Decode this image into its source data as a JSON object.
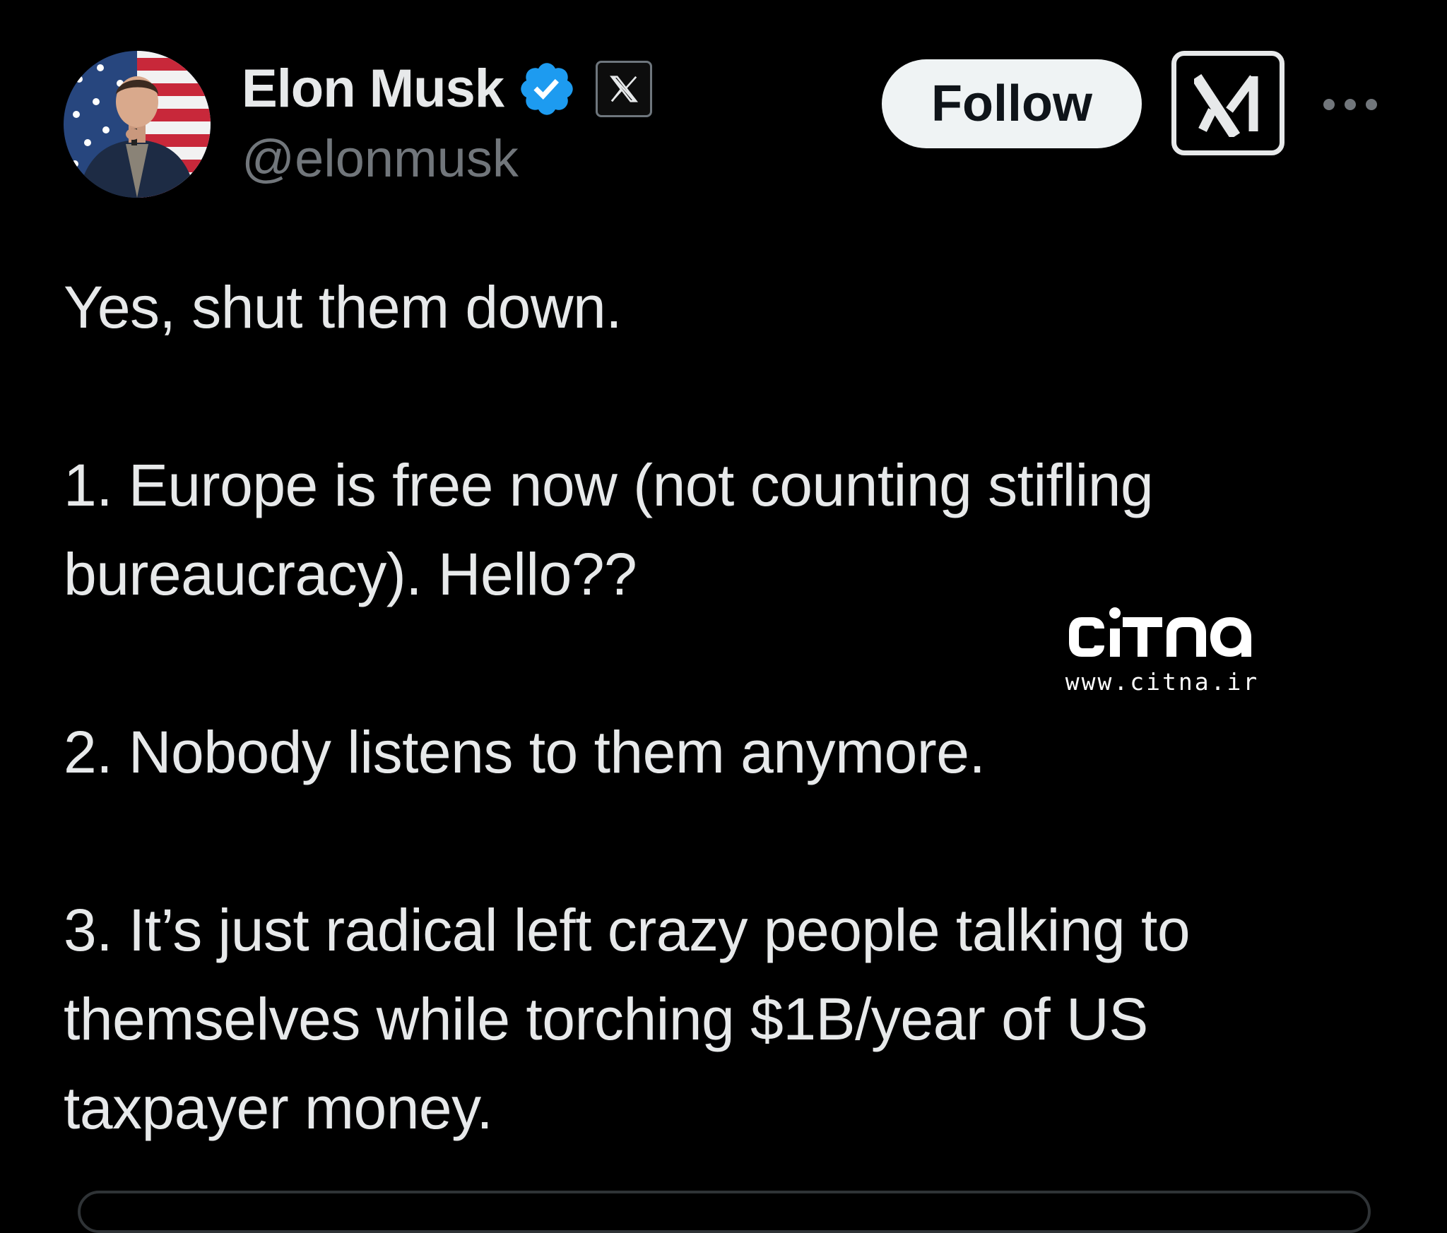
{
  "author": {
    "display_name": "Elon Musk",
    "handle": "@elonmusk",
    "verified_color": "#1d9bf0",
    "avatar_icon": "profile-photo-with-flag"
  },
  "actions": {
    "follow_label": "Follow",
    "grok_icon": "grok-icon",
    "more_icon": "more-dots-icon"
  },
  "tweet": {
    "paragraphs": [
      {
        "lines": [
          "Yes, shut them down."
        ]
      },
      {
        "lines": [
          "1. Europe is free now (not counting stifling",
          "bureaucracy). Hello??"
        ]
      },
      {
        "lines": [
          "2. Nobody listens to them anymore."
        ]
      },
      {
        "lines": [
          "3. It’s just radical left crazy people talking to",
          "themselves while torching $1B/year of US",
          "taxpayer money."
        ]
      }
    ]
  },
  "watermark": {
    "logo_text": "CiTNa",
    "url": "www.citna.ir"
  }
}
